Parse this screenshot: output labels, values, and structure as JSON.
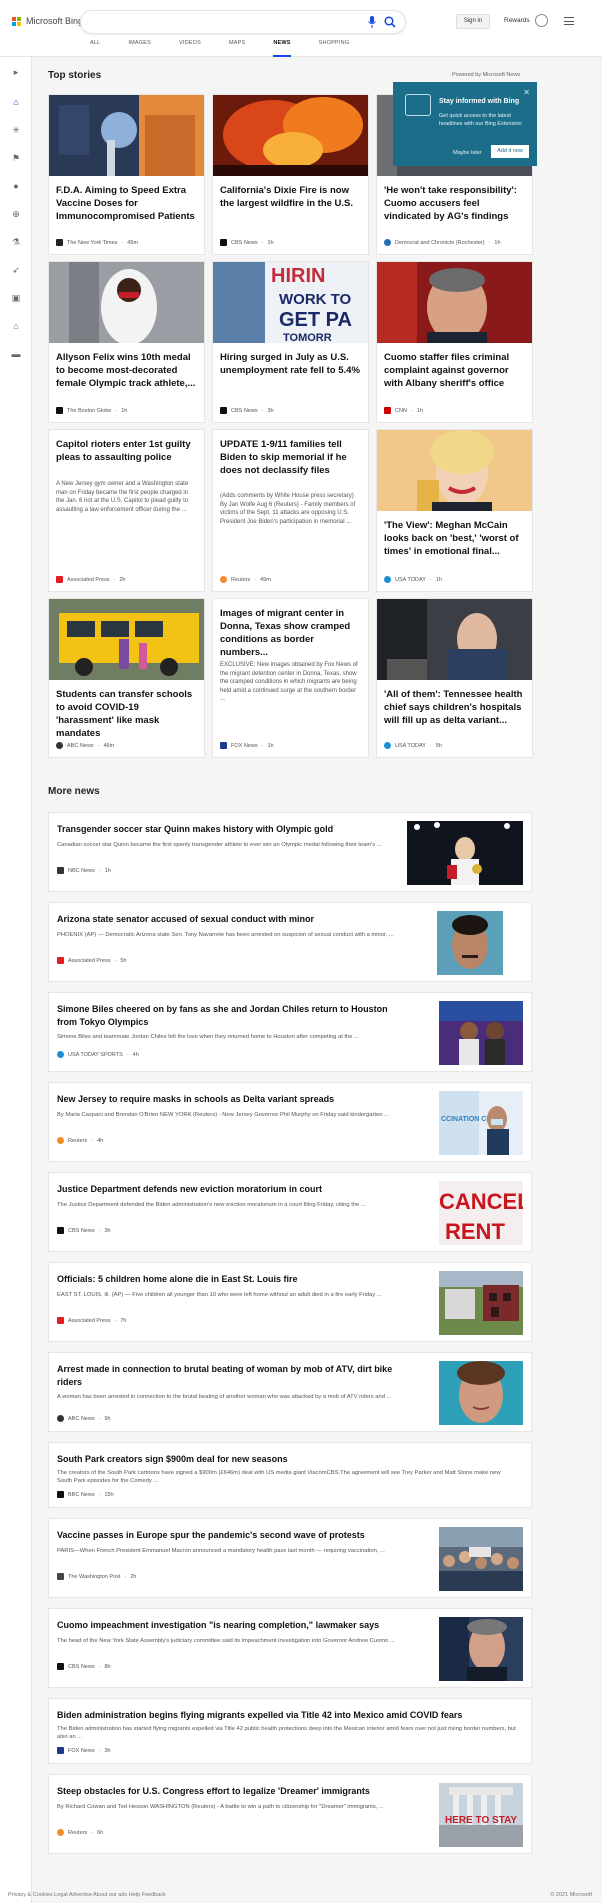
{
  "header": {
    "logo_text": "Microsoft Bing",
    "search_value": "",
    "signin_label": "Sign in",
    "rewards_label": "Rewards",
    "tabs": [
      {
        "label": "ALL"
      },
      {
        "label": "IMAGES"
      },
      {
        "label": "VIDEOS"
      },
      {
        "label": "MAPS"
      },
      {
        "label": "NEWS"
      },
      {
        "label": "SHOPPING"
      }
    ],
    "active_tab": "NEWS"
  },
  "sidebar_icons": [
    "expand-icon",
    "home-icon",
    "science-icon",
    "flag-icon",
    "location-icon",
    "world-icon",
    "technology-icon",
    "rocket-icon",
    "entertainment-icon",
    "politics-icon",
    "money-icon"
  ],
  "colors": {
    "accent": "#174ae4",
    "popup": "#1b6d8a"
  },
  "top_stories": {
    "title": "Top stories",
    "powered_by": "Powered by Microsoft News",
    "cards": [
      {
        "title": "F.D.A. Aiming to Speed Extra Vaccine Doses for Immunocompromised Patients",
        "snippet": "",
        "provider": "The New York Times",
        "time": "45m"
      },
      {
        "title": "California's Dixie Fire is now the largest wildfire in the U.S.",
        "snippet": "",
        "provider": "CBS News",
        "time": "1h"
      },
      {
        "title": "'He won't take responsibility': Cuomo accusers feel vindicated by AG's findings",
        "snippet": "",
        "provider": "Democrat and Chronicle (Rochester)",
        "time": "1h"
      },
      {
        "title": "Allyson Felix wins 10th medal to become most-decorated female Olympic track athlete,...",
        "snippet": "",
        "provider": "The Boston Globe",
        "time": "1h"
      },
      {
        "title": "Hiring surged in July as U.S. unemployment rate fell to 5.4%",
        "snippet": "",
        "provider": "CBS News",
        "time": "3h"
      },
      {
        "title": "Cuomo staffer files criminal complaint against governor with Albany sheriff's office",
        "snippet": "",
        "provider": "CNN",
        "time": "1h"
      },
      {
        "title": "Capitol rioters enter 1st guilty pleas to assaulting police",
        "snippet": "A New Jersey gym owner and a Washington state man on Friday became the first people charged in the Jan. 6 riot at the U.S. Capitol to plead guilty to assaulting a law enforcement officer during the ...",
        "provider": "Associated Press",
        "time": "2h"
      },
      {
        "title": "UPDATE 1-9/11 families tell Biden to skip memorial if he does not declassify files",
        "snippet": "(Adds comments by White House press secretary) By Jan Wolfe Aug 6 (Reuters) - Family members of victims of the Sept. 11 attacks are opposing U.S. President Joe Biden's participation in memorial ...",
        "provider": "Reuters",
        "time": "49m"
      },
      {
        "title": "'The View': Meghan McCain looks back on 'best,' 'worst of times' in emotional final...",
        "snippet": "",
        "provider": "USA TODAY",
        "time": "1h"
      },
      {
        "title": "Students can transfer schools to avoid COVID-19 'harassment' like mask mandates",
        "snippet": "",
        "provider": "ABC News",
        "time": "46m"
      },
      {
        "title": "Images of migrant center in Donna, Texas show cramped conditions as border numbers...",
        "snippet": "EXCLUSIVE: New images obtained by Fox News of the migrant detention center in Donna, Texas, show the cramped conditions in which migrants are being held amid a continued surge at the southern border ...",
        "provider": "FOX News",
        "time": "1h"
      },
      {
        "title": "'All of them': Tennessee health chief says children's hospitals will fill up as delta variant...",
        "snippet": "",
        "provider": "USA TODAY",
        "time": "5h"
      }
    ]
  },
  "popup": {
    "title": "Stay informed with Bing",
    "description": "Get quick access to the latest headlines with our Bing Extension",
    "later_label": "Maybe later",
    "add_label": "Add it now"
  },
  "more_news": {
    "title": "More news",
    "items": [
      {
        "title": "Transgender soccer star Quinn makes history with Olympic gold",
        "snippet": "Canadian soccer star Quinn became the first openly transgender athlete to ever win an Olympic medal following their team's ...",
        "provider": "NBC News",
        "time": "1h"
      },
      {
        "title": "Arizona state senator accused of sexual conduct with minor",
        "snippet": "PHOENIX (AP) — Democratic Arizona state Sen. Tony Navarrete has been arrested on suspicion of sexual conduct with a minor, ...",
        "provider": "Associated Press",
        "time": "5h"
      },
      {
        "title": "Simone Biles cheered on by fans as she and Jordan Chiles return to Houston from Tokyo Olympics",
        "snippet": "Simone Biles and teammate Jordan Chiles felt the love when they returned home to Houston after competing at the ...",
        "provider": "USA TODAY SPORTS",
        "time": "4h"
      },
      {
        "title": "New Jersey to require masks in schools as Delta variant spreads",
        "snippet": "By Maria Caspani and Brendan O'Brien NEW YORK (Reuters) - New Jersey Governor Phil Murphy on Friday said kindergarten ...",
        "provider": "Reuters",
        "time": "4h"
      },
      {
        "title": "Justice Department defends new eviction moratorium in court",
        "snippet": "The Justice Department defended the Biden administration's new eviction moratorium in a court filing Friday, citing the ...",
        "provider": "CBS News",
        "time": "3h"
      },
      {
        "title": "Officials: 5 children home alone die in East St. Louis fire",
        "snippet": "EAST ST. LOUIS, Ill. (AP) — Five children all younger than 10 who were left home without an adult died in a fire early Friday ...",
        "provider": "Associated Press",
        "time": "7h"
      },
      {
        "title": "Arrest made in connection to brutal beating of woman by mob of ATV, dirt bike riders",
        "snippet": "A woman has been arrested in connection to the brutal beating of another woman who was attacked by a mob of ATV riders and ...",
        "provider": "ABC News",
        "time": "9h"
      },
      {
        "title": "South Park creators sign $900m deal for new seasons",
        "snippet": "The creators of the South Park cartoons have signed a $900m (£646m) deal with US media giant ViacomCBS.The agreement will see Trey Parker and Matt Stone make new South Park episodes for the Comedy ...",
        "provider": "BBC News",
        "time": "15h"
      },
      {
        "title": "Vaccine passes in Europe spur the pandemic's second wave of protests",
        "snippet": "PARIS—When French President Emmanuel Macron announced a mandatory health pass last month — requiring vaccination, ...",
        "provider": "The Washington Post",
        "time": "2h"
      },
      {
        "title": "Cuomo impeachment investigation \"is nearing completion,\" lawmaker says",
        "snippet": "The head of the New York State Assembly's judiciary committee said its impeachment investigation into Governor Andrew Cuomo ...",
        "provider": "CBS News",
        "time": "8h"
      },
      {
        "title": "Biden administration begins flying migrants expelled via Title 42 into Mexico amid COVID fears",
        "snippet": "The Biden administration has started flying migrants expelled via Title 42 public health protections deep into the Mexican interior amid fears over not just rising border numbers, but also an ...",
        "provider": "FOX News",
        "time": "3h"
      },
      {
        "title": "Steep obstacles for U.S. Congress effort to legalize 'Dreamer' immigrants",
        "snippet": "By Richard Cowan and Ted Hesson WASHINGTON (Reuters) - A battle to win a path to citizenship for \"Dreamer\" immigrants, ...",
        "provider": "Reuters",
        "time": "6h"
      }
    ]
  },
  "thumb_texts": {
    "hiring_line1": "HIRIN",
    "hiring_line2": "WORK TO",
    "hiring_line3": "GET PA",
    "hiring_line4": "TOMORR",
    "vaccination": "CCINATION CLINIC",
    "cancel": "CANCEL",
    "rent": "RENT",
    "stay": "HERE TO STAY"
  },
  "footer": {
    "left": "Privacy & Cookies   Legal   Advertise   About our ads   Help   Feedback",
    "right": "© 2021 Microsoft"
  }
}
